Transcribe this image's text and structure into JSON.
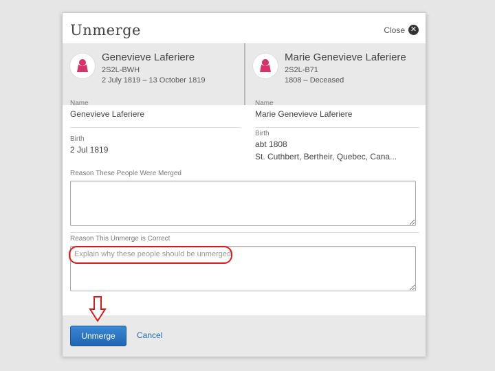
{
  "dialog": {
    "title": "Unmerge",
    "close_label": "Close"
  },
  "persons": [
    {
      "name": "Genevieve Laferiere",
      "id": "2S2L-BWH",
      "dates": "2 July 1819 – 13 October 1819",
      "avatar_icon": "female-silhouette-icon"
    },
    {
      "name": "Marie Genevieve Laferiere",
      "id": "2S2L-B71",
      "dates": "1808 – Deceased",
      "avatar_icon": "female-silhouette-icon"
    }
  ],
  "details": {
    "name_label": "Name",
    "birth_label": "Birth",
    "left": {
      "name": "Genevieve Laferiere",
      "birth_date": "2 Jul 1819"
    },
    "right": {
      "name": "Marie Genevieve Laferiere",
      "birth_date": "abt 1808",
      "birth_place": "St. Cuthbert, Bertheir, Quebec, Cana..."
    }
  },
  "form": {
    "merged_reason_label": "Reason These People Were Merged",
    "merged_reason_value": "",
    "unmerge_reason_label": "Reason This Unmerge is Correct",
    "unmerge_reason_placeholder": "Explain why these people should be unmerged."
  },
  "footer": {
    "unmerge_button": "Unmerge",
    "cancel_link": "Cancel"
  },
  "colors": {
    "accent": "#1f66b3",
    "avatar_female": "#d6336c",
    "annotation": "#e01818"
  }
}
